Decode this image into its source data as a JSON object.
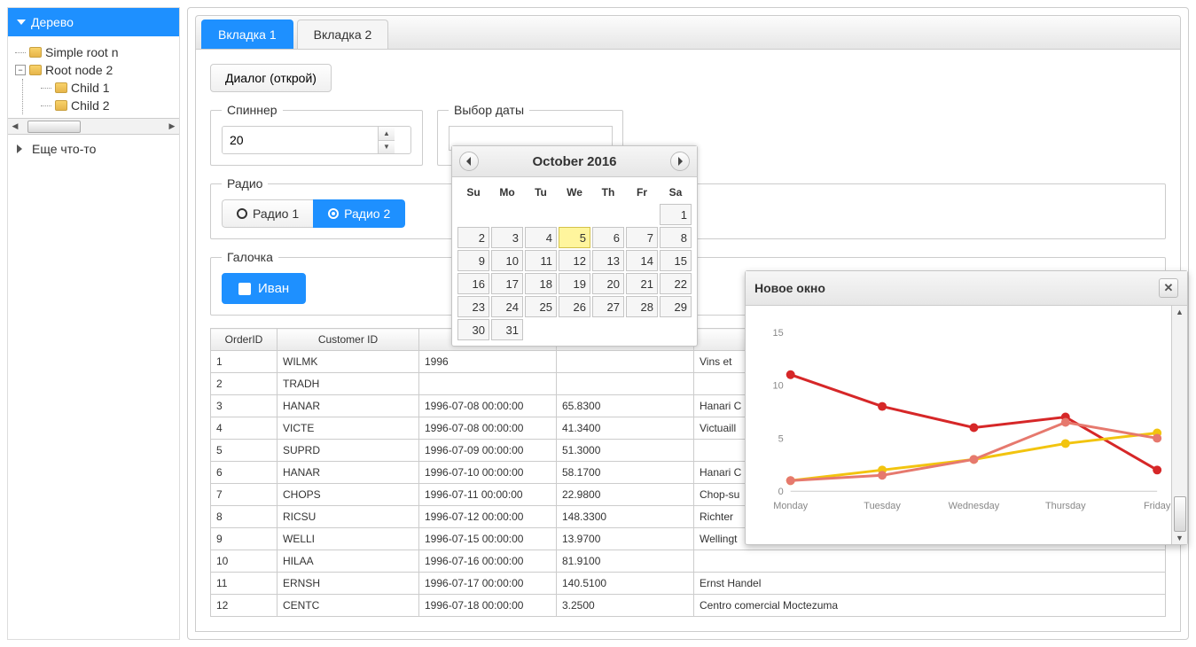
{
  "sidebar": {
    "accordion": [
      {
        "label": "Дерево",
        "expanded": true
      },
      {
        "label": "Еще что-то",
        "expanded": false
      }
    ],
    "tree": [
      {
        "label": "Simple root n",
        "children": []
      },
      {
        "label": "Root node 2",
        "expanded": true,
        "children": [
          {
            "label": "Child 1"
          },
          {
            "label": "Child 2"
          }
        ]
      }
    ]
  },
  "tabs": [
    "Вкладка 1",
    "Вкладка 2"
  ],
  "active_tab": 0,
  "dialog_button": "Диалог (открой)",
  "spinner": {
    "label": "Спиннер",
    "value": "20"
  },
  "datepick": {
    "label": "Выбор даты",
    "value": ""
  },
  "radio": {
    "label": "Радио",
    "options": [
      "Радио 1",
      "Радио 2"
    ],
    "selected": 1
  },
  "check": {
    "label": "Галочка",
    "button": "Иван",
    "checked": false
  },
  "table": {
    "columns": [
      "OrderID",
      "Customer ID",
      "",
      "",
      ""
    ],
    "col_widths": [
      "75px",
      "160px",
      "155px",
      "155px",
      "auto"
    ],
    "rows": [
      [
        "1",
        "WILMK",
        "1996",
        "",
        "Vins et"
      ],
      [
        "2",
        "TRADH",
        "",
        "",
        ""
      ],
      [
        "3",
        "HANAR",
        "1996-07-08 00:00:00",
        "65.8300",
        "Hanari C"
      ],
      [
        "4",
        "VICTE",
        "1996-07-08 00:00:00",
        "41.3400",
        "Victuaill"
      ],
      [
        "5",
        "SUPRD",
        "1996-07-09 00:00:00",
        "51.3000",
        ""
      ],
      [
        "6",
        "HANAR",
        "1996-07-10 00:00:00",
        "58.1700",
        "Hanari C"
      ],
      [
        "7",
        "CHOPS",
        "1996-07-11 00:00:00",
        "22.9800",
        "Chop-su"
      ],
      [
        "8",
        "RICSU",
        "1996-07-12 00:00:00",
        "148.3300",
        "Richter"
      ],
      [
        "9",
        "WELLI",
        "1996-07-15 00:00:00",
        "13.9700",
        "Wellingt"
      ],
      [
        "10",
        "HILAA",
        "1996-07-16 00:00:00",
        "81.9100",
        ""
      ],
      [
        "11",
        "ERNSH",
        "1996-07-17 00:00:00",
        "140.5100",
        "Ernst Handel"
      ],
      [
        "12",
        "CENTC",
        "1996-07-18 00:00:00",
        "3.2500",
        "Centro comercial Moctezuma"
      ]
    ]
  },
  "datepicker": {
    "title": "October 2016",
    "weekdays": [
      "Su",
      "Mo",
      "Tu",
      "We",
      "Th",
      "Fr",
      "Sa"
    ],
    "first_day_offset": 6,
    "days_in_month": 31,
    "today": 5
  },
  "chart_window": {
    "title": "Новое окно"
  },
  "chart_data": {
    "type": "line",
    "categories": [
      "Monday",
      "Tuesday",
      "Wednesday",
      "Thursday",
      "Friday"
    ],
    "series": [
      {
        "name": "red",
        "color": "#d62728",
        "values": [
          11,
          8,
          6,
          7,
          2
        ]
      },
      {
        "name": "yellow",
        "color": "#f2c40f",
        "values": [
          1,
          2,
          3,
          4.5,
          5.5
        ]
      },
      {
        "name": "pink",
        "color": "#e6796e",
        "values": [
          1,
          1.5,
          3,
          6.5,
          5
        ]
      }
    ],
    "ylim": [
      0,
      15
    ],
    "yticks": [
      0,
      5,
      10,
      15
    ]
  }
}
